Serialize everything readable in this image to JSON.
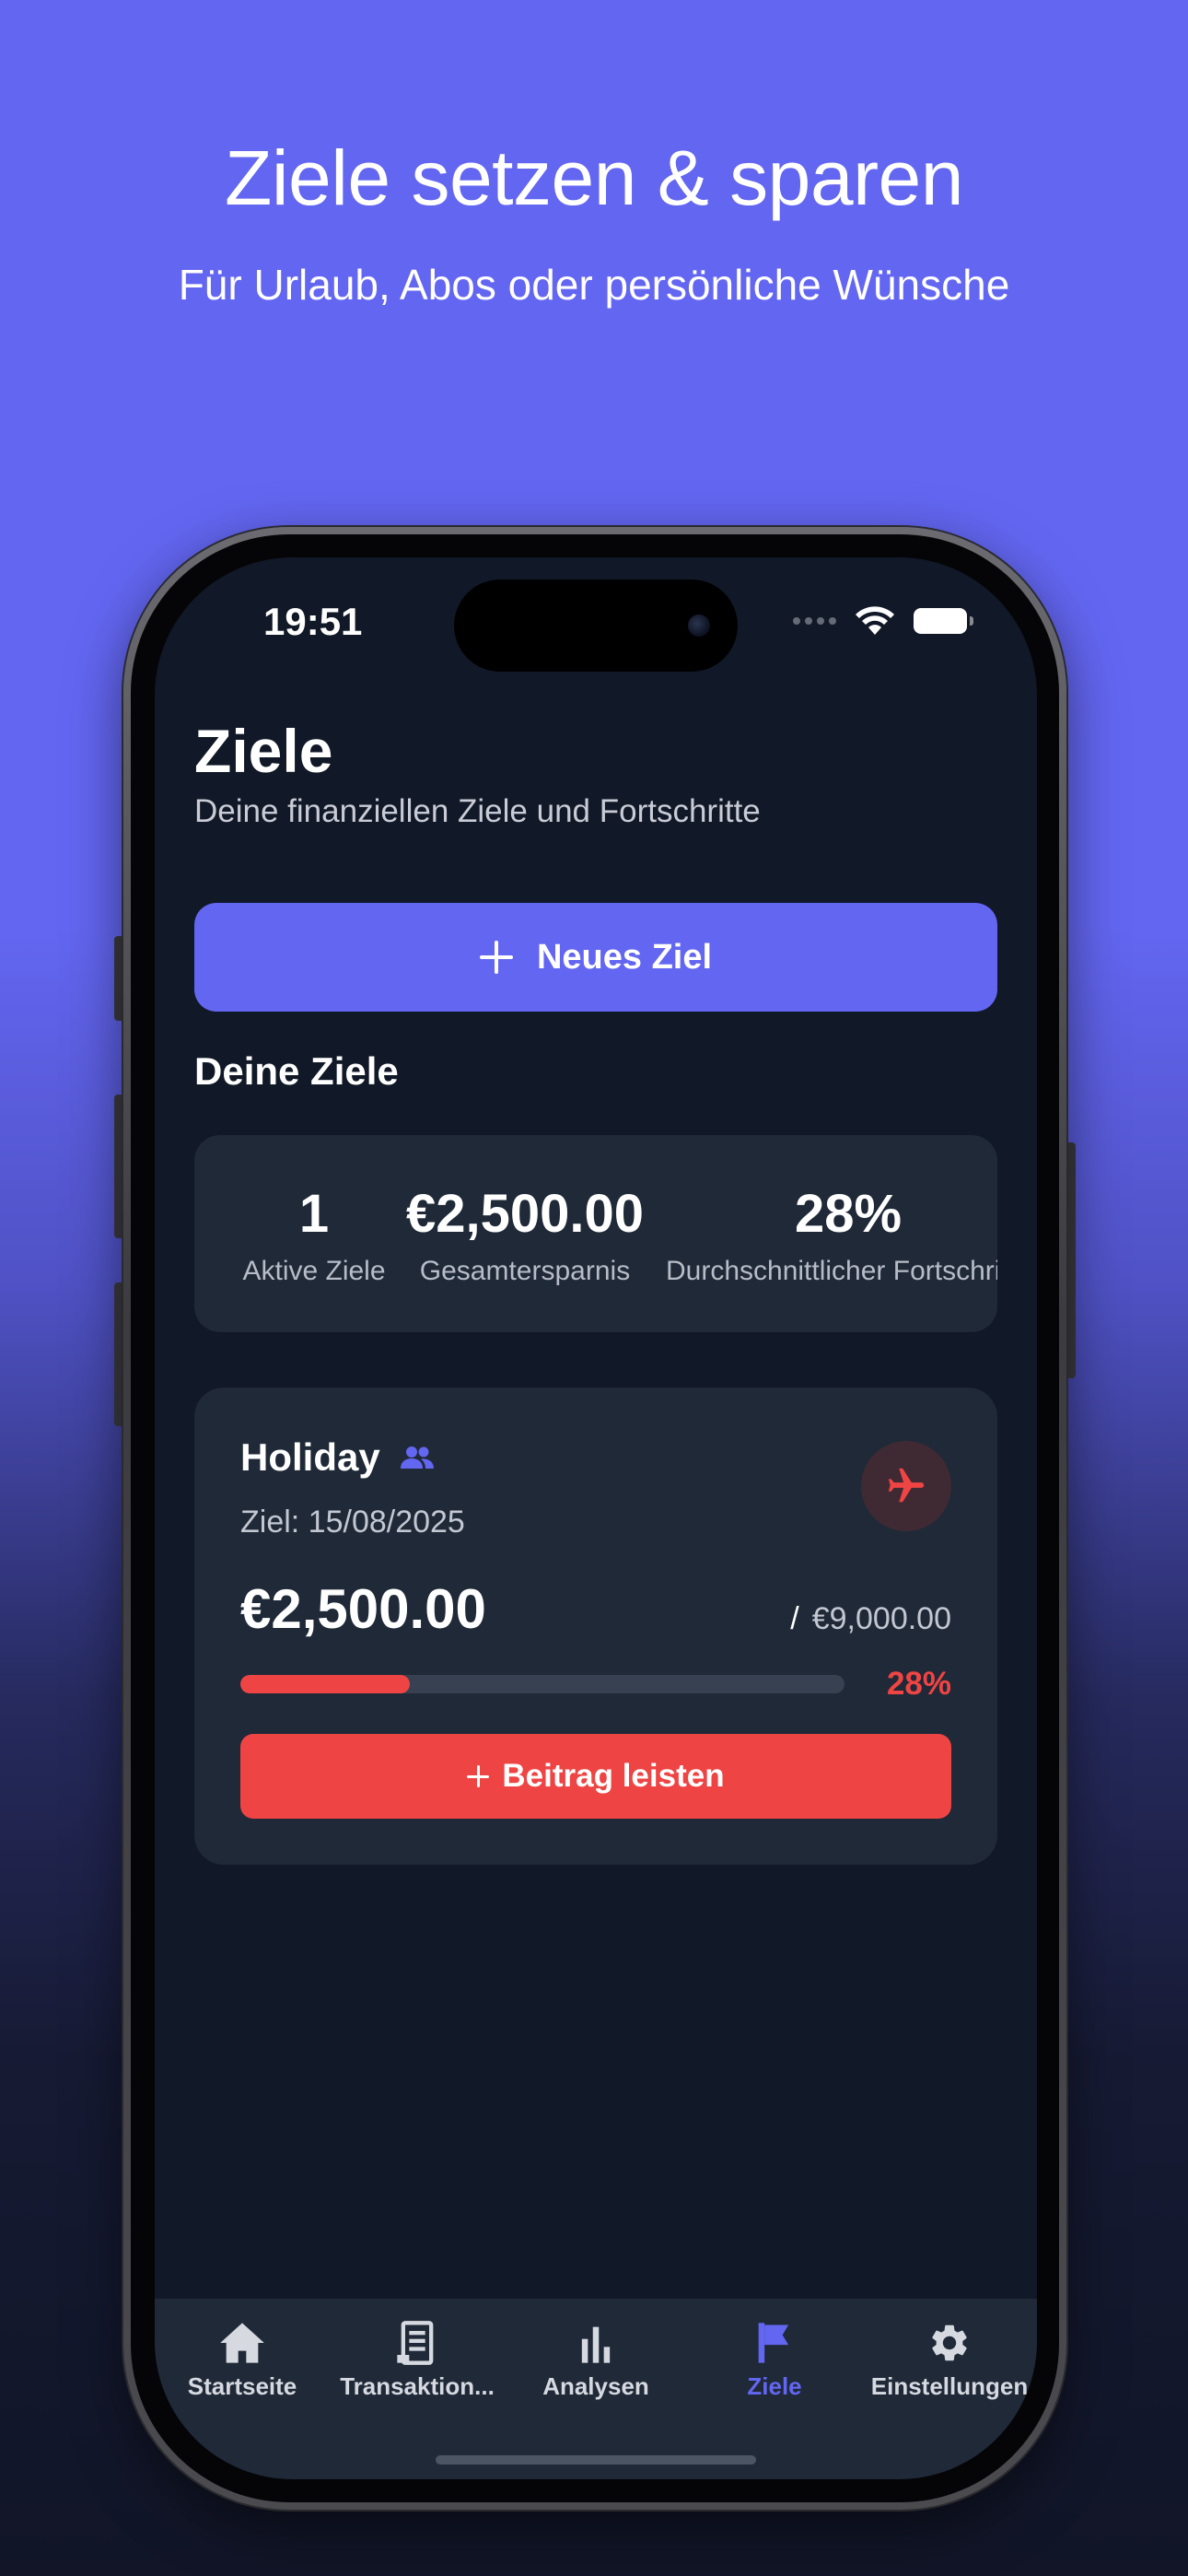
{
  "promo": {
    "title": "Ziele setzen & sparen",
    "subtitle": "Für Urlaub, Abos oder persönliche Wünsche"
  },
  "status_bar": {
    "time": "19:51"
  },
  "header": {
    "title": "Ziele",
    "subtitle": "Deine finanziellen Ziele und Fortschritte"
  },
  "new_goal_button": {
    "label": "Neues Ziel"
  },
  "goals_section": {
    "title": "Deine Ziele"
  },
  "stats": [
    {
      "value": "1",
      "label": "Aktive Ziele"
    },
    {
      "value": "€2,500.00",
      "label": "Gesamtersparnis"
    },
    {
      "value": "28%",
      "label": "Durchschnittlicher Fortschritt"
    }
  ],
  "goal": {
    "name": "Holiday",
    "shared_icon": "people-icon",
    "category_icon": "airplane-icon",
    "date": "Ziel: 15/08/2025",
    "amount": "€2,500.00",
    "separator": "/",
    "target": "€9,000.00",
    "progress": 0.28,
    "progress_label": "28%",
    "contribute_label": "Beitrag leisten"
  },
  "tabs": [
    {
      "label": "Startseite",
      "icon": "home-icon"
    },
    {
      "label": "Transaktion...",
      "icon": "receipt-icon"
    },
    {
      "label": "Analysen",
      "icon": "bar-chart-icon"
    },
    {
      "label": "Ziele",
      "icon": "flag-icon",
      "active": true
    },
    {
      "label": "Einstellungen",
      "icon": "gear-icon"
    }
  ],
  "colors": {
    "accent": "#6366f1",
    "danger": "#ef4444",
    "background": "#111827",
    "card": "#1f2937"
  }
}
